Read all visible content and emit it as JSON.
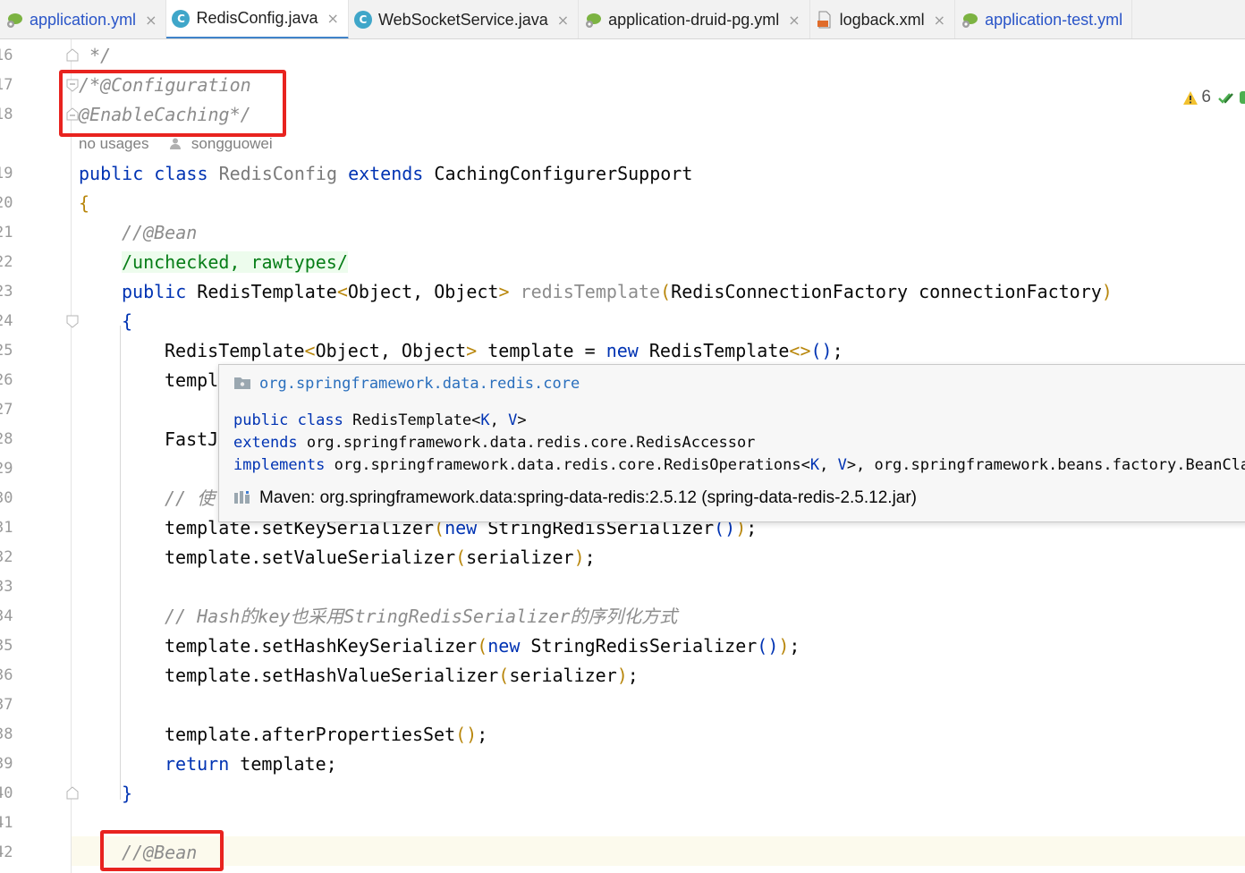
{
  "tabs": [
    {
      "label": "application.yml",
      "kind": "yml",
      "active": false
    },
    {
      "label": "RedisConfig.java",
      "kind": "class",
      "active": true
    },
    {
      "label": "WebSocketService.java",
      "kind": "class",
      "active": false
    },
    {
      "label": "application-druid-pg.yml",
      "kind": "yml",
      "active": false
    },
    {
      "label": "logback.xml",
      "kind": "xml",
      "active": false
    },
    {
      "label": "application-test.yml",
      "kind": "yml",
      "active": false
    }
  ],
  "class_icon_letter": "C",
  "close_glyph": "×",
  "line_numbers": [
    "16",
    "17",
    "18",
    "19",
    "20",
    "21",
    "22",
    "23",
    "24",
    "25",
    "26",
    "27",
    "28",
    "29",
    "30",
    "31",
    "32",
    "33",
    "34",
    "35",
    "36",
    "37",
    "38",
    "39",
    "40",
    "41",
    "42"
  ],
  "inlay": {
    "usages": "no usages",
    "author": "songguowei"
  },
  "inspection": {
    "warnings": "6"
  },
  "code": {
    "l16": "*/",
    "l17": "/*@Configuration",
    "l18": "@EnableCaching*/",
    "l19": {
      "kw1": "public",
      "kw2": "class",
      "name": "RedisConfig",
      "kw3": "extends",
      "parent": "CachingConfigurerSupport"
    },
    "l20": "{",
    "l21": "//@Bean",
    "l22": "/unchecked, rawtypes/",
    "l23": {
      "kw": "public",
      "type": "RedisTemplate",
      "lt": "<",
      "generics": "Object, Object",
      "gt": ">",
      "name": "redisTemplate",
      "lp": "(",
      "params": "RedisConnectionFactory connectionFactory",
      "rp": ")"
    },
    "l24": "{",
    "l25": {
      "a": "RedisTemplate",
      "lt": "<",
      "b": "Object, Object",
      "gt": ">",
      "c": " template = ",
      "kw": "new",
      "d": " RedisTemplate",
      "e": "<>",
      "f": "()",
      "g": ";"
    },
    "l26": "templ",
    "l28": "FastJ",
    "l30": "// 使",
    "l31": {
      "a": "template.setKeySerializer",
      "b": "(",
      "kw": "new",
      "c": " StringRedisSerializer",
      "d": "()",
      "e": ")",
      "f": ";"
    },
    "l32": {
      "a": "template.setValueSerializer",
      "b": "(",
      "c": "serializer",
      "d": ")",
      "e": ";"
    },
    "l34": "// Hash的key也采用StringRedisSerializer的序列化方式",
    "l35": {
      "a": "template.setHashKeySerializer",
      "b": "(",
      "kw": "new",
      "c": " StringRedisSerializer",
      "d": "()",
      "e": ")",
      "f": ";"
    },
    "l36": {
      "a": "template.setHashValueSerializer",
      "b": "(",
      "c": "serializer",
      "d": ")",
      "e": ";"
    },
    "l38": {
      "a": "template.afterPropertiesSet",
      "b": "()",
      "c": ";"
    },
    "l39": {
      "kw": "return",
      "rest": " template;"
    },
    "l40": "}",
    "l42": "//@Bean"
  },
  "popup": {
    "package": "org.springframework.data.redis.core",
    "line1": {
      "kw1": "public",
      "kw2": "class",
      "rest": "RedisTemplate<",
      "k": "K",
      "sep": ", ",
      "v": "V",
      "end": ">"
    },
    "line2": {
      "kw": "extends",
      "rest": "org.springframework.data.redis.core.RedisAccessor"
    },
    "line3": {
      "kw": "implements",
      "rest": "org.springframework.data.redis.core.RedisOperations<",
      "k": "K",
      "sep": ", ",
      "v": "V",
      "tail": ">, org.springframework.beans.factory.BeanClassLoaderAware"
    },
    "maven": "Maven: org.springframework.data:spring-data-redis:2.5.12 (spring-data-redis-2.5.12.jar)"
  },
  "colors": {
    "keyword": "#0033b3",
    "comment": "#8c8c8c",
    "annotation_box": "#e8231f",
    "link": "#2a6fbd"
  }
}
